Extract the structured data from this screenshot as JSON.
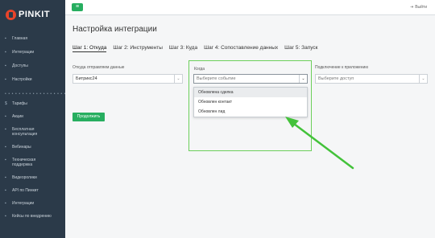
{
  "logo": {
    "text": "PINKIT"
  },
  "sidebar": {
    "items": [
      {
        "icon": "▪",
        "label": "Главная"
      },
      {
        "icon": "▪",
        "label": "Интеграции"
      },
      {
        "icon": "▪",
        "label": "Доступы"
      },
      {
        "icon": "▪",
        "label": "Настройки"
      }
    ],
    "dots": "• • • • • • • • • • • • • • • • • • • • •",
    "items2": [
      {
        "icon": "$",
        "label": "Тарифы"
      },
      {
        "icon": "▪",
        "label": "Акции"
      },
      {
        "icon": "▪",
        "label": "Бесплатная консультация"
      },
      {
        "icon": "▪",
        "label": "Вебинары"
      },
      {
        "icon": "▪",
        "label": "Техническая поддержка"
      },
      {
        "icon": "▪",
        "label": "Видеоролики"
      },
      {
        "icon": "▪",
        "label": "API по Пинкит"
      },
      {
        "icon": "▪",
        "label": "Интеграции"
      },
      {
        "icon": "▪",
        "label": "Кейсы по внедрению"
      }
    ]
  },
  "topbar": {
    "menu_icon": "≡",
    "logout_label": "Выйти"
  },
  "page": {
    "title": "Настройка интеграции",
    "tabs": [
      "Шаг 1: Откуда",
      "Шаг 2: Инструменты",
      "Шаг 3: Куда",
      "Шаг 4: Сопоставление данных",
      "Шаг 5: Запуск"
    ]
  },
  "form": {
    "source": {
      "label": "Откуда отправляем данные",
      "value": "Битрикс24"
    },
    "when": {
      "label": "Когда",
      "placeholder": "Выберите событие"
    },
    "connection": {
      "label": "Подключение к приложению",
      "placeholder": "Выберите доступ"
    },
    "options": [
      "Обновлена сделка",
      "Обновлен контакт",
      "Обновлен лид"
    ],
    "submit_label": "Продолжить"
  },
  "colors": {
    "accent": "#27ae60",
    "highlight": "#6ccf5b",
    "sidebar": "#2b3a49"
  }
}
